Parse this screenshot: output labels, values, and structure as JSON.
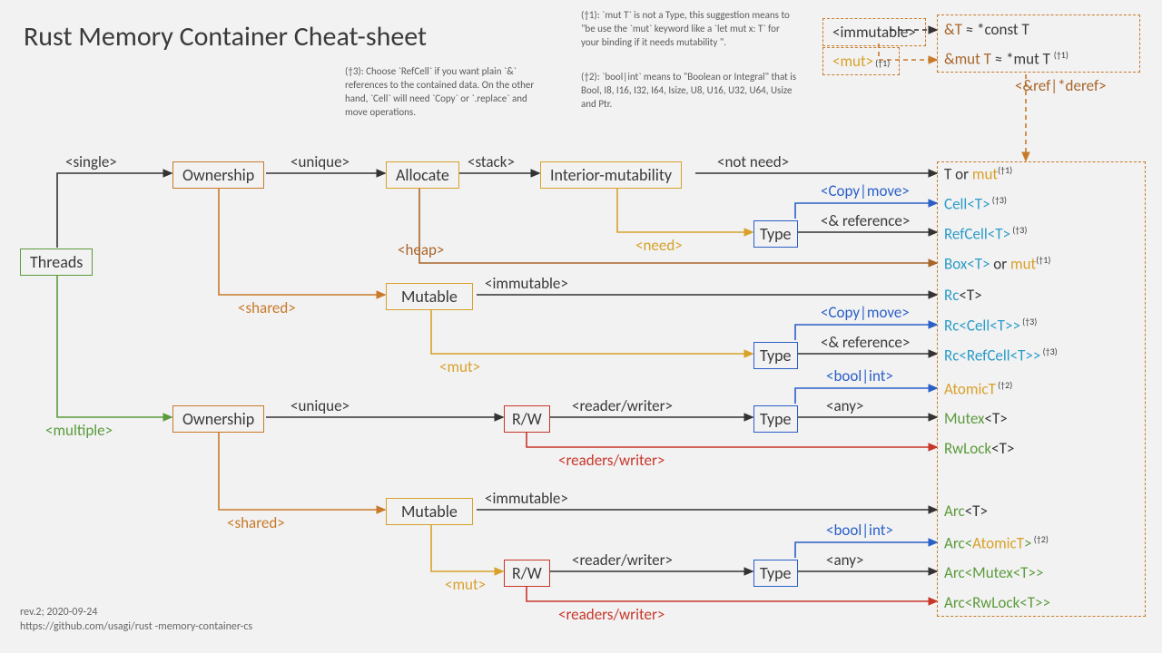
{
  "title": "Rust Memory Container Cheat-sheet",
  "notes": {
    "t3": "(†3): Choose `RefCell` if you want plain `&` references to the contained data. On the other hand, `Cell` will need `Copy` or `.replace` and move operations.",
    "t1": "(†1): `mut T` is not a Type, this suggestion means to \"be use the `mut` keyword like a `let mut x: T` for your binding if it needs mutability \".",
    "t2": "(†2): `bool|int` means to \"Boolean or Integral\" that is Bool, I8, I16, I32, I64, Isize, U8, U16, U32, U64,  Usize and Ptr."
  },
  "nodes": {
    "threads": "Threads",
    "ownership": "Ownership",
    "allocate": "Allocate",
    "intmut": "Interior-mutability",
    "mutable": "Mutable",
    "type": "Type",
    "rw": "R/W"
  },
  "edges": {
    "single": "<single>",
    "multiple": "<multiple>",
    "unique": "<unique>",
    "shared": "<shared>",
    "stack": "<stack>",
    "heap": "<heap>",
    "notneed": "<not need>",
    "need": "<need>",
    "copymove": "<Copy|move>",
    "andref": "<& reference>",
    "immutable": "<immutable>",
    "mut": "<mut>",
    "readerwriter": "<reader/writer>",
    "readerswriter": "<readers/writer>",
    "boolint": "<bool|int>",
    "any": "<any>",
    "refderef": "<&ref|*deref>"
  },
  "refbox": {
    "immutable": "<immutable>",
    "mut_label": "<mut>",
    "mut_sup": "(†1)",
    "line1_a": "&T ≈ *const T",
    "line2_a": "&mut T ≈ *mut T ",
    "line2_sup": "(†1)"
  },
  "results": {
    "r1_a": "T or ",
    "r1_b": "mut",
    "r1_sup": "(†1)",
    "r2": "Cell<T>",
    "r2_sup": " (†3)",
    "r3": "RefCell<T>",
    "r3_sup": " (†3)",
    "r4_a": "Box<T>",
    "r4_b": " or ",
    "r4_c": "mut",
    "r4_sup": "(†1)",
    "r5_a": "Rc",
    "r5_b": "<T>",
    "r6_a": "Rc<",
    "r6_b": "Cell<T>",
    "r6_c": ">",
    "r6_sup": " (†3)",
    "r7_a": "Rc<",
    "r7_b": "RefCell<T>",
    "r7_c": ">",
    "r7_sup": " (†3)",
    "r8": "AtomicT",
    "r8_sup": " (†2)",
    "r9_a": "Mutex",
    "r9_b": "<T>",
    "r10_a": "RwLock",
    "r10_b": "<T>",
    "r11_a": "Arc",
    "r11_b": "<T>",
    "r12_a": "Arc<",
    "r12_b": "AtomicT",
    "r12_c": ">",
    "r12_sup": " (†2)",
    "r13_a": "Arc<",
    "r13_b": "Mutex<T>",
    "r13_c": ">",
    "r14_a": "Arc<",
    "r14_b": "RwLock<T>",
    "r14_c": ">"
  },
  "footer": {
    "rev": "rev.2; 2020-09-24",
    "url": "https://github.com/usagi/rust -memory-container-cs"
  }
}
